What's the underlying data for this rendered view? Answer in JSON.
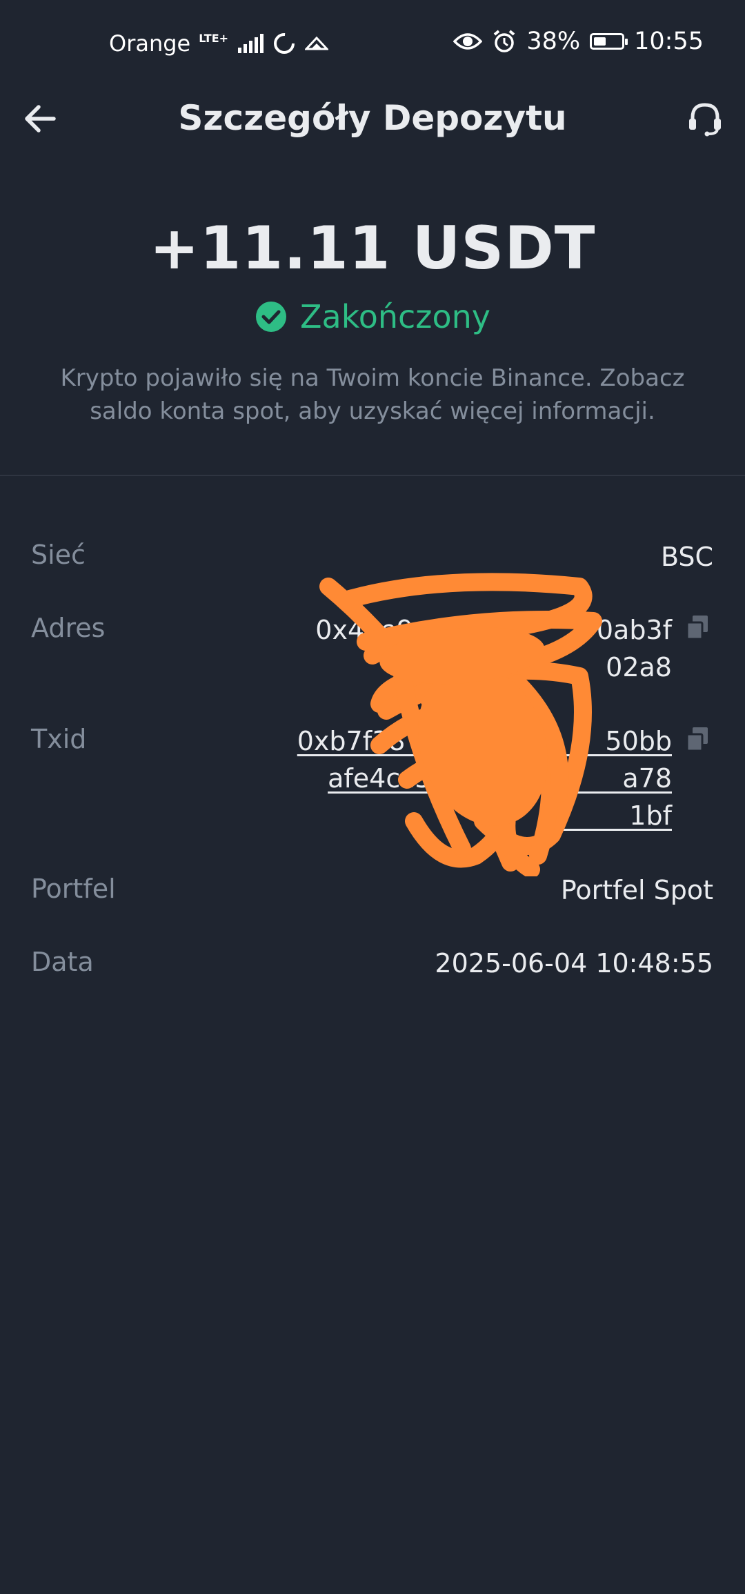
{
  "status_bar": {
    "carrier": "Orange",
    "network": "LTE+",
    "battery": "38%",
    "battery_level": 0.38,
    "time": "10:55"
  },
  "header": {
    "title": "Szczegóły Depozytu"
  },
  "summary": {
    "amount": "+11.11 USDT",
    "status": "Zakończony",
    "status_color": "#2ebd85",
    "description": "Krypto pojawiło się na Twoim koncie Binance. Zobacz saldo konta spot, aby uzyskać więcej informacji."
  },
  "details": {
    "network": {
      "label": "Sieć",
      "value": "BSC"
    },
    "address": {
      "label": "Adres",
      "line1": "0x4ee9  83                0ab3f",
      "line2": "02a8"
    },
    "txid": {
      "label": "Txid",
      "line1": "0xb7f38  67  9              50bb",
      "line2": "afe4cc3e5                   a78",
      "line3": "5         1bf"
    },
    "wallet": {
      "label": "Portfel",
      "value": "Portfel Spot"
    },
    "date": {
      "label": "Data",
      "value": "2025-06-04 10:48:55"
    }
  },
  "colors": {
    "background": "#1f2530",
    "text_primary": "#eaecef",
    "text_secondary": "#848e9c",
    "success": "#2ebd85",
    "redaction": "#ff8a35"
  },
  "icons": [
    "back-arrow-icon",
    "headset-icon",
    "check-circle-icon",
    "copy-icon",
    "eye-icon",
    "alarm-icon",
    "battery-icon",
    "signal-icon",
    "sync-icon"
  ]
}
